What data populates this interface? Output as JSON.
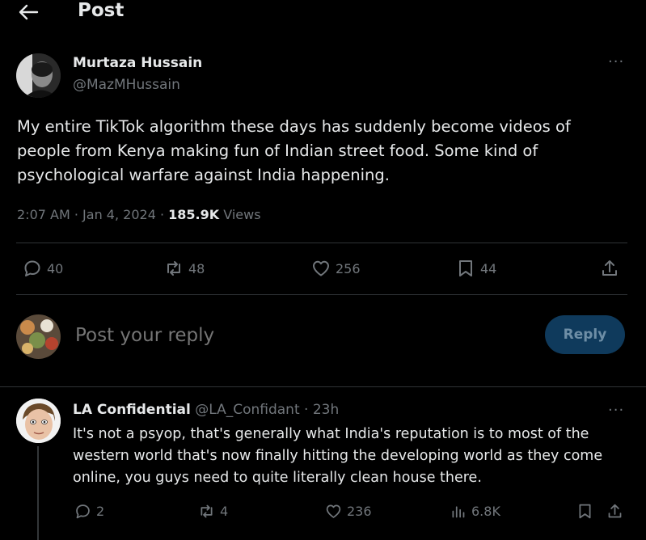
{
  "header": {
    "title": "Post",
    "back_icon": "arrow-left-icon"
  },
  "post": {
    "author_name": "Murtaza Hussain",
    "author_handle": "@MazMHussain",
    "body": "My entire TikTok algorithm these days has suddenly become videos of people from Kenya making fun of Indian street food. Some kind of psychological warfare against India happening.",
    "time": "2:07 AM",
    "date": "Jan 4, 2024",
    "views_count": "185.9K",
    "views_label": "Views",
    "sep": "·",
    "more": "···",
    "stats": {
      "replies": "40",
      "reposts": "48",
      "likes": "256",
      "bookmarks": "44"
    }
  },
  "composer": {
    "placeholder": "Post your reply",
    "button_label": "Reply"
  },
  "reply": {
    "author_name": "LA Confidential",
    "author_handle": "@LA_Confidant",
    "time": "23h",
    "sep": "·",
    "more": "···",
    "body": "It's not a psyop, that's generally what India's reputation is to most of the western world that's now finally hitting the developing world as they come online, you guys need to quite literally clean house there.",
    "stats": {
      "replies": "2",
      "reposts": "4",
      "likes": "236",
      "views": "6.8K"
    }
  },
  "colors": {
    "background": "#000000",
    "text": "#e7e9ea",
    "muted": "#71767b",
    "reply_button": "#0f3a5c",
    "divider": "#2f3336"
  }
}
